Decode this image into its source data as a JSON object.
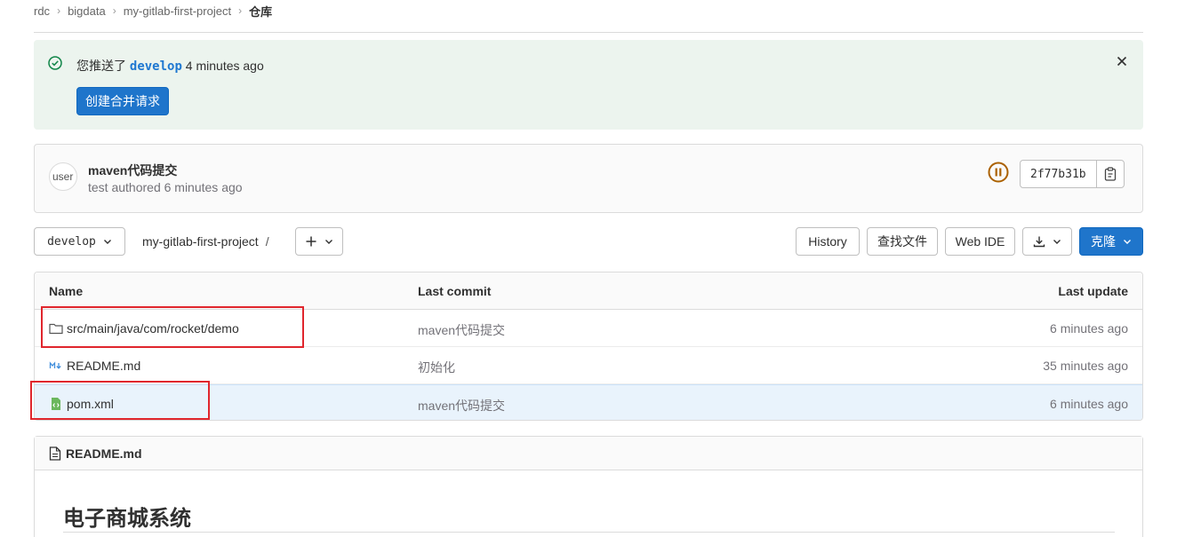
{
  "breadcrumb": [
    {
      "label": "rdc"
    },
    {
      "label": "bigdata"
    },
    {
      "label": "my-gitlab-first-project"
    },
    {
      "label": "仓库"
    }
  ],
  "alert": {
    "prefix": "您推送了",
    "branch": "develop",
    "suffix": "4 minutes ago",
    "button_label": "创建合并请求"
  },
  "commit": {
    "avatar_text": "user",
    "title": "maven代码提交",
    "author": "test authored 6 minutes ago",
    "sha": "2f77b31b"
  },
  "toolbar": {
    "branch": "develop",
    "path": "my-gitlab-first-project",
    "path_sep": "/",
    "history": "History",
    "find_file": "查找文件",
    "web_ide": "Web IDE",
    "clone": "克隆"
  },
  "table": {
    "headers": {
      "name": "Name",
      "last_commit": "Last commit",
      "last_update": "Last update"
    },
    "rows": [
      {
        "icon": "folder-icon",
        "name": "src/main/java/com/rocket/demo",
        "commit": "maven代码提交",
        "updated": "6 minutes ago"
      },
      {
        "icon": "markdown-icon",
        "name": "README.md",
        "commit": "初始化",
        "updated": "35 minutes ago"
      },
      {
        "icon": "xml-file-icon",
        "name": "pom.xml",
        "commit": "maven代码提交",
        "updated": "6 minutes ago"
      }
    ]
  },
  "readme": {
    "filename": "README.md",
    "heading": "电子商城系统"
  },
  "colors": {
    "primary": "#1f75cb",
    "alert_bg": "#ecf4ee",
    "success": "#108548",
    "pipeline": "#ab6100",
    "highlight_box": "#e0262d"
  }
}
